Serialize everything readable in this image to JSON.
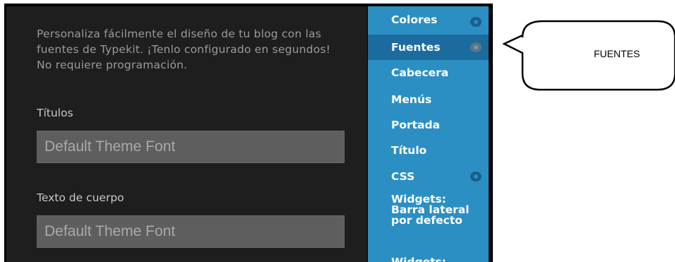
{
  "description": "Personaliza fácilmente el diseño de tu blog con las fuentes de Typekit. ¡Tenlo configurado en segundos! No requiere programación.",
  "titles_label": "Títulos",
  "titles_font": "Default Theme Font",
  "body_label": "Texto de cuerpo",
  "body_font": "Default Theme Font",
  "nav": {
    "items": [
      {
        "label": "Colores"
      },
      {
        "label": "Fuentes"
      },
      {
        "label": "Cabecera"
      },
      {
        "label": "Menús"
      },
      {
        "label": "Portada"
      },
      {
        "label": "Título"
      },
      {
        "label": "CSS"
      },
      {
        "label": "Widgets: Barra lateral por defecto"
      },
      {
        "label": "Widgets:"
      }
    ]
  },
  "callout_text": "FUENTES",
  "colors": {
    "panel": "#1e1e1e",
    "nav": "#2b8fc4",
    "nav_active": "#1c6b9e"
  }
}
